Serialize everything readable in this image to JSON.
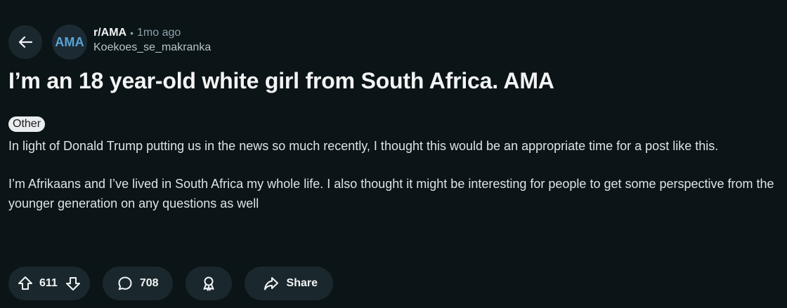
{
  "post": {
    "subreddit": "r/AMA",
    "separator": "•",
    "time_ago": "1mo ago",
    "author": "Koekoes_se_makranka",
    "avatar_text": "AMA",
    "title": "I’m an 18 year-old white girl from South Africa. AMA",
    "flair": "Other",
    "body": [
      "In light of Donald Trump putting us in the news so much recently, I thought this would be an appropriate time for a post like this.",
      "I’m Afrikaans and I’ve lived in South Africa my whole life. I also thought it might be interesting for people to get some perspective from the younger generation on any questions as well"
    ]
  },
  "actions": {
    "votes": "611",
    "comments": "708",
    "share_label": "Share"
  },
  "icons": {
    "back": "arrow-left-icon",
    "upvote": "upvote-arrow-icon",
    "downvote": "downvote-arrow-icon",
    "comment": "comment-bubble-icon",
    "award": "award-icon",
    "share": "share-arrow-icon"
  },
  "colors": {
    "background": "#0b1416",
    "pill": "#1a282d",
    "avatar_text": "#5ba4d6",
    "flair_bg": "#eaedef",
    "muted": "#8ba2ad"
  }
}
